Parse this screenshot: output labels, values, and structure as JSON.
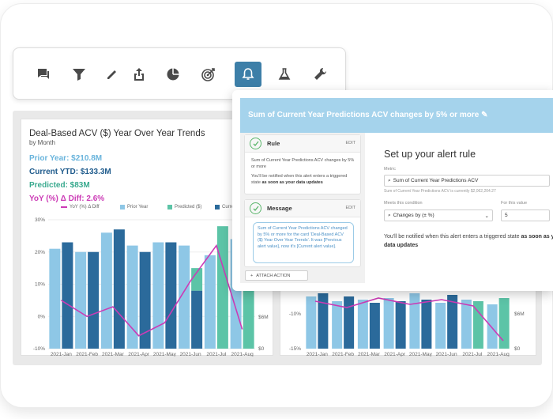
{
  "toolbar": {
    "tools": [
      {
        "icon": "comment-icon"
      },
      {
        "icon": "filter-icon"
      },
      {
        "icon": "pencil-icon"
      },
      {
        "icon": "share-icon"
      },
      {
        "icon": "pie-chart-icon"
      },
      {
        "icon": "target-icon"
      },
      {
        "icon": "bell-icon",
        "active": true
      },
      {
        "icon": "flask-icon"
      },
      {
        "icon": "wrench-icon"
      }
    ],
    "active_color": "#3d7fa8"
  },
  "card": {
    "title": "Deal-Based ACV ($) Year Over Year Trends",
    "subtitle": "by Month",
    "kpis": {
      "prior": "Prior Year: $210.8M",
      "ytd": "Current YTD: $133.3M",
      "predicted": "Predicted: $83M",
      "diff": "YoY (%) Δ Diff: 2.6%"
    },
    "legend": {
      "diff": "YoY (%) Δ Diff",
      "prior": "Prior Year",
      "predicted": "Predicted ($)",
      "current": "Current Year"
    }
  },
  "colors": {
    "prior": "#8ec7e6",
    "current": "#2b6a9b",
    "predicted": "#5cc4a7",
    "line": "#cc3bb6"
  },
  "chart_data": [
    {
      "type": "bar",
      "title": "Deal-Based ACV ($) Year Over Year Trends",
      "categories": [
        "2021-Jan",
        "2021-Feb",
        "2021-Mar",
        "2021-Apr",
        "2021-May",
        "2021-Jun",
        "2021-Jul",
        "2021-Aug"
      ],
      "y_axis_left_ticks": [
        "30%",
        "20%",
        "10%",
        "0%",
        "-10%"
      ],
      "y_axis_right_ticks": [
        "$6M",
        "$0"
      ],
      "ylim_left": [
        -10,
        30
      ],
      "series": [
        {
          "name": "Prior Year",
          "type": "bar",
          "values": [
            21,
            20,
            26,
            22,
            23,
            22,
            19,
            24
          ]
        },
        {
          "name": "Current Year",
          "type": "bar",
          "values": [
            23,
            20,
            27,
            20,
            23,
            8,
            0,
            0
          ]
        },
        {
          "name": "Predicted ($)",
          "type": "bar",
          "values": [
            0,
            0,
            0,
            0,
            0,
            15,
            28,
            22
          ]
        },
        {
          "name": "YoY (%) Δ Diff",
          "type": "line",
          "values": [
            5,
            0,
            3,
            -6,
            -2,
            11,
            22,
            -4
          ]
        }
      ]
    },
    {
      "type": "bar",
      "categories": [
        "2021-Jan",
        "2021-Feb",
        "2021-Mar",
        "2021-Apr",
        "2021-May",
        "2021-Jun",
        "2021-Jul",
        "2021-Aug"
      ],
      "y_axis_left_ticks": [
        "-10%",
        "-15%"
      ],
      "y_axis_right_ticks": [
        "$6M",
        "$0"
      ]
    }
  ],
  "alert": {
    "title": "Sum of Current Year Predictions ACV changes by 5% or more",
    "rule_label": "Rule",
    "message_label": "Message",
    "edit": "EDIT",
    "rule_text": "Sum of Current Year Predictions ACV changes by 5% or more",
    "rule_note": "You'll be notified when this alert enters a triggered state",
    "rule_note_bold": "as soon as your data updates",
    "message_text": "Sum of Current Year Predictions ACV changed by 5% or more for the card 'Deal-Based ACV ($) Year Over Year Trends'. It was [Previous alert value], now it's [Current alert value].",
    "attach": "ATTACH ACTION",
    "setup_title": "Set up your alert rule",
    "metric_label": "Metric",
    "metric_value": "Sum of Current Year Predictions ACV",
    "metric_hint": "Sum of Current Year Predictions ACV is currently $2,062,204.27",
    "condition_label": "Meets this condition",
    "condition_value": "Changes by (± %)",
    "value_label": "For this value",
    "value_value": "5",
    "notify_text": "You'll be notified when this alert enters a triggered state",
    "notify_bold": "as soon as your data updates"
  }
}
